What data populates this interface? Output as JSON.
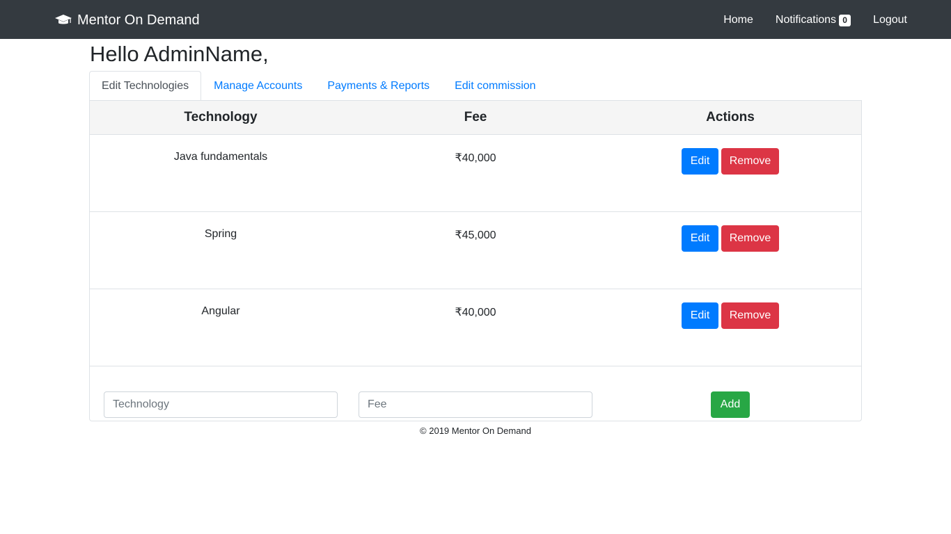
{
  "navbar": {
    "brand": "Mentor On Demand",
    "brand_icon": "graduation-cap-icon",
    "links": {
      "home": "Home",
      "notifications": "Notifications",
      "notifications_count": "0",
      "logout": "Logout"
    }
  },
  "greeting": "Hello AdminName,",
  "tabs": [
    {
      "label": "Edit Technologies",
      "active": true
    },
    {
      "label": "Manage Accounts",
      "active": false
    },
    {
      "label": "Payments & Reports",
      "active": false
    },
    {
      "label": "Edit commission",
      "active": false
    }
  ],
  "table": {
    "headers": [
      "Technology",
      "Fee",
      "Actions"
    ],
    "rows": [
      {
        "technology": "Java fundamentals",
        "fee": "₹40,000",
        "edit": "Edit",
        "remove": "Remove"
      },
      {
        "technology": "Spring",
        "fee": "₹45,000",
        "edit": "Edit",
        "remove": "Remove"
      },
      {
        "technology": "Angular",
        "fee": "₹40,000",
        "edit": "Edit",
        "remove": "Remove"
      }
    ]
  },
  "add_form": {
    "technology_placeholder": "Technology",
    "fee_placeholder": "Fee",
    "add_label": "Add"
  },
  "footer": "© 2019 Mentor On Demand",
  "colors": {
    "navbar_bg": "#343a40",
    "primary": "#007bff",
    "danger": "#dc3545",
    "success": "#28a745",
    "header_bg": "#f5f5f5"
  }
}
